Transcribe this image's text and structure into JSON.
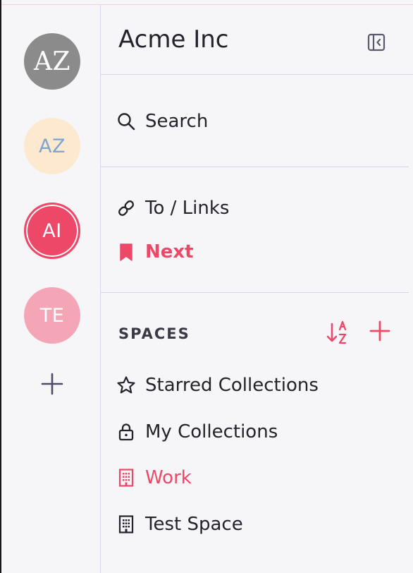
{
  "colors": {
    "accent": "#ee4868",
    "text": "#23232b",
    "divider": "#d6d3e8",
    "background": "#f6f6f9"
  },
  "workspaces": [
    {
      "initials": "AZ",
      "style": "grey",
      "active": false
    },
    {
      "initials": "AZ",
      "style": "peach",
      "active": false
    },
    {
      "initials": "AI",
      "style": "red",
      "active": true
    },
    {
      "initials": "TE",
      "style": "pink",
      "active": false
    }
  ],
  "rail": {
    "add_icon": "plus-icon"
  },
  "sidebar": {
    "title": "Acme Inc",
    "collapse_icon": "sidebar-collapse-icon",
    "search": {
      "label": "Search",
      "icon": "search-icon"
    },
    "links": [
      {
        "label": "To / Links",
        "icon": "link-icon",
        "active": false
      },
      {
        "label": "Next",
        "icon": "bookmark-icon",
        "active": true
      }
    ],
    "spaces": {
      "heading": "SPACES",
      "sort_icon": "sort-az-icon",
      "add_icon": "plus-icon",
      "items": [
        {
          "label": "Starred Collections",
          "icon": "star-icon",
          "active": false
        },
        {
          "label": "My Collections",
          "icon": "lock-icon",
          "active": false
        },
        {
          "label": "Work",
          "icon": "building-icon",
          "active": true
        },
        {
          "label": "Test Space",
          "icon": "building-icon",
          "active": false
        }
      ]
    }
  }
}
